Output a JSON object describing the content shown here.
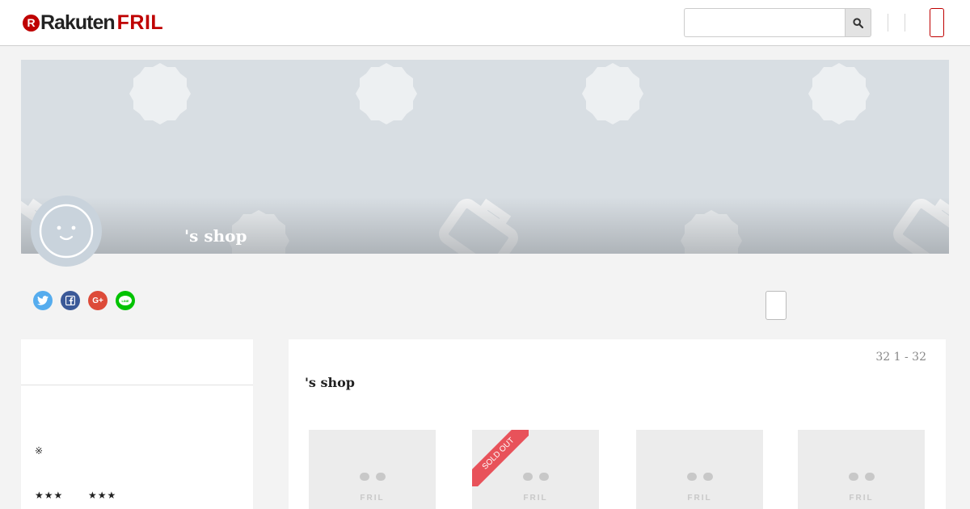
{
  "header": {
    "logo": {
      "rakuten": "Rakuten",
      "fril": "FRIL",
      "r_mark": "R"
    },
    "search": {
      "placeholder": ""
    },
    "accent_color": "#bf0000"
  },
  "shop": {
    "cover_title": "'s shop",
    "title": "'s shop",
    "count_text": "32 1 - 32"
  },
  "social": [
    {
      "name": "twitter",
      "color": "#55acee",
      "glyph": ""
    },
    {
      "name": "facebook",
      "color": "#3b5998",
      "glyph": "f"
    },
    {
      "name": "google-plus",
      "color": "#dd4b39",
      "glyph": "G+"
    },
    {
      "name": "line",
      "color": "#00c300",
      "glyph": "LINE"
    }
  ],
  "sidebar": {
    "note": "※",
    "stars_left": "★★★",
    "stars_right": "★★★"
  },
  "items": [
    {
      "sold_out": false,
      "logo_text": "FRIL"
    },
    {
      "sold_out": true,
      "logo_text": "FRIL",
      "badge": "SOLD OUT"
    },
    {
      "sold_out": false,
      "logo_text": "FRIL"
    },
    {
      "sold_out": false,
      "logo_text": "FRIL"
    }
  ]
}
